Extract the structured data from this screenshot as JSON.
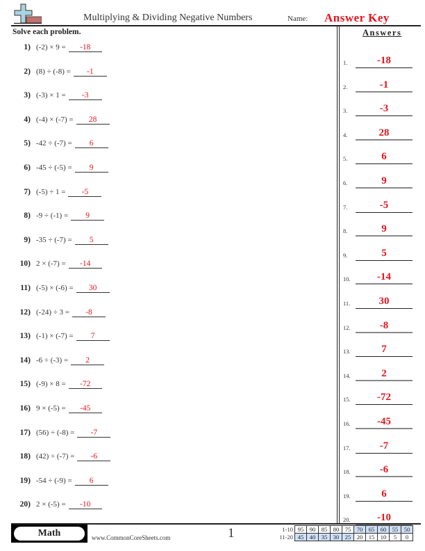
{
  "header": {
    "title": "Multiplying & Dividing Negative Numbers",
    "name_label": "Name:",
    "name_value": "Answer Key",
    "logo_icon": "plus-symbol-logo"
  },
  "instructions": "Solve each problem.",
  "answers_title": "Answers",
  "colors": {
    "answer_red": "#e8141c",
    "score_highlight": "#cfe0f7"
  },
  "problems": [
    {
      "num": "1)",
      "expr": "(-2) × 9 =",
      "answer": "-18"
    },
    {
      "num": "2)",
      "expr": "(8) ÷ (-8) =",
      "answer": "-1"
    },
    {
      "num": "3)",
      "expr": "(-3) × 1 =",
      "answer": "-3"
    },
    {
      "num": "4)",
      "expr": "(-4) × (-7) =",
      "answer": "28"
    },
    {
      "num": "5)",
      "expr": "-42 ÷ (-7) =",
      "answer": "6"
    },
    {
      "num": "6)",
      "expr": "-45 ÷ (-5) =",
      "answer": "9"
    },
    {
      "num": "7)",
      "expr": "(-5) ÷ 1 =",
      "answer": "-5"
    },
    {
      "num": "8)",
      "expr": "-9 ÷ (-1) =",
      "answer": "9"
    },
    {
      "num": "9)",
      "expr": "-35 ÷ (-7) =",
      "answer": "5"
    },
    {
      "num": "10)",
      "expr": "2 × (-7) =",
      "answer": "-14"
    },
    {
      "num": "11)",
      "expr": "(-5) × (-6) =",
      "answer": "30"
    },
    {
      "num": "12)",
      "expr": "(-24) ÷ 3 =",
      "answer": "-8"
    },
    {
      "num": "13)",
      "expr": "(-1) × (-7) =",
      "answer": "7"
    },
    {
      "num": "14)",
      "expr": "-6 ÷ (-3) =",
      "answer": "2"
    },
    {
      "num": "15)",
      "expr": "(-9) × 8 =",
      "answer": "-72"
    },
    {
      "num": "16)",
      "expr": "9 × (-5) =",
      "answer": "-45"
    },
    {
      "num": "17)",
      "expr": "(56) ÷ (-8) =",
      "answer": "-7"
    },
    {
      "num": "18)",
      "expr": "(42) ÷ (-7) =",
      "answer": "-6"
    },
    {
      "num": "19)",
      "expr": "-54 ÷ (-9) =",
      "answer": "6"
    },
    {
      "num": "20)",
      "expr": "2 × (-5) =",
      "answer": "-10"
    }
  ],
  "answer_key": [
    {
      "num": "1.",
      "value": "-18"
    },
    {
      "num": "2.",
      "value": "-1"
    },
    {
      "num": "3.",
      "value": "-3"
    },
    {
      "num": "4.",
      "value": "28"
    },
    {
      "num": "5.",
      "value": "6"
    },
    {
      "num": "6.",
      "value": "9"
    },
    {
      "num": "7.",
      "value": "-5"
    },
    {
      "num": "8.",
      "value": "9"
    },
    {
      "num": "9.",
      "value": "5"
    },
    {
      "num": "10.",
      "value": "-14"
    },
    {
      "num": "11.",
      "value": "30"
    },
    {
      "num": "12.",
      "value": "-8"
    },
    {
      "num": "13.",
      "value": "7"
    },
    {
      "num": "14.",
      "value": "2"
    },
    {
      "num": "15.",
      "value": "-72"
    },
    {
      "num": "16.",
      "value": "-45"
    },
    {
      "num": "17.",
      "value": "-7"
    },
    {
      "num": "18.",
      "value": "-6"
    },
    {
      "num": "19.",
      "value": "6"
    },
    {
      "num": "20.",
      "value": "-10"
    }
  ],
  "footer": {
    "subject": "Math",
    "website": "www.CommonCoreSheets.com",
    "page_number": "1",
    "score_rows": [
      {
        "label": "1-10",
        "scores": [
          "95",
          "90",
          "85",
          "80",
          "75",
          "70",
          "65",
          "60",
          "55",
          "50"
        ],
        "highlighted": [
          false,
          false,
          false,
          false,
          false,
          true,
          true,
          true,
          true,
          true
        ]
      },
      {
        "label": "11-20",
        "scores": [
          "45",
          "40",
          "35",
          "30",
          "25",
          "20",
          "15",
          "10",
          "5",
          "0"
        ],
        "highlighted": [
          true,
          true,
          true,
          true,
          true,
          false,
          false,
          false,
          false,
          false
        ]
      }
    ]
  }
}
